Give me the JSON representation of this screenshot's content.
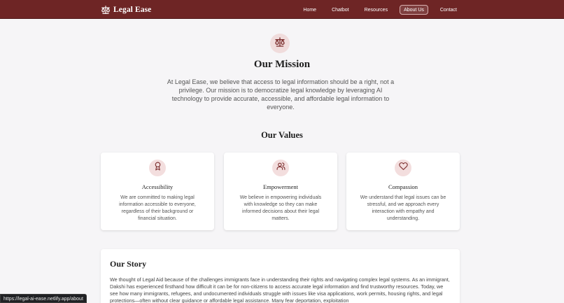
{
  "brand": {
    "name": "Legal Ease",
    "icon": "scales-icon"
  },
  "nav": {
    "items": [
      {
        "label": "Home"
      },
      {
        "label": "Chatbot"
      },
      {
        "label": "Resources"
      },
      {
        "label": "About Us",
        "active": true
      },
      {
        "label": "Contact"
      }
    ]
  },
  "mission": {
    "icon": "scales-icon",
    "title": "Our Mission",
    "text": "At Legal Ease, we believe that access to legal information should be a right, not a privilege. Our mission is to democratize legal knowledge by leveraging AI technology to provide accurate, accessible, and affordable legal information to everyone."
  },
  "values": {
    "title": "Our Values",
    "items": [
      {
        "icon": "award-icon",
        "title": "Accessibility",
        "text": "We are committed to making legal information accessible to everyone, regardless of their background or financial situation."
      },
      {
        "icon": "users-icon",
        "title": "Empowerment",
        "text": "We believe in empowering individuals with knowledge so they can make informed decisions about their legal matters."
      },
      {
        "icon": "heart-icon",
        "title": "Compassion",
        "text": "We understand that legal issues can be stressful, and we approach every interaction with empathy and understanding."
      }
    ]
  },
  "story": {
    "title": "Our Story",
    "text": "We thought of Legal Aid because of the challenges immigrants face in understanding their rights and navigating complex legal systems. As an immigrant, Dakshi has experienced firsthand how difficult it can be for non-citizens to access accurate legal information and find trustworthy resources. Today, we see how many immigrants, refugees, and undocumented individuals struggle with issues like visa applications, work permits, housing rights, and legal protections—often without clear guidance or affordable legal assistance. Many fear deportation, exploitation"
  },
  "status_bar": {
    "url": "https://legal-ai-ease.netlify.app/about"
  },
  "colors": {
    "navbar": "#6e2525",
    "accent": "#7a2b2b",
    "icon_bg": "#f3dede",
    "page_bg": "#f6f5f7"
  }
}
